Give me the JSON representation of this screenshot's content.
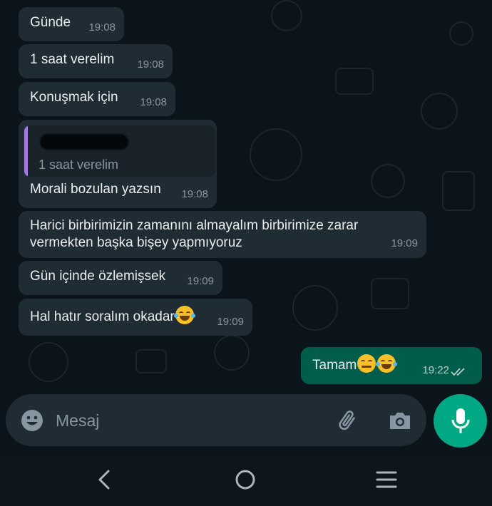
{
  "messages": [
    {
      "text": "Günde",
      "time": "19:08",
      "direction": "in"
    },
    {
      "text": "1 saat verelim",
      "time": "19:08",
      "direction": "in"
    },
    {
      "text": "Konuşmak için",
      "time": "19:08",
      "direction": "in"
    },
    {
      "quoted_text": "1 saat verelim",
      "text": "Morali bozulan yazsın",
      "time": "19:08",
      "direction": "in"
    },
    {
      "text_line1": "Harici birbirimizin zamanını almayalım birbirimize zarar",
      "text_line2": "vermekten başka bişey yapmıyoruz",
      "time": "19:09",
      "direction": "in"
    },
    {
      "text": "Gün içinde özlemişsek",
      "time": "19:09",
      "direction": "in"
    },
    {
      "text": "Hal hatır soralım okadar",
      "time": "19:09",
      "direction": "in",
      "emoji": "tears-of-joy"
    },
    {
      "text": "Tamam",
      "time": "19:22",
      "direction": "out",
      "emojis": [
        "winking-face",
        "tears-of-joy"
      ],
      "status": "read"
    }
  ],
  "composer": {
    "placeholder": "Mesaj"
  },
  "icons": {
    "emoji": "emoji-icon",
    "attach": "paperclip-icon",
    "camera": "camera-icon",
    "mic": "microphone-icon",
    "nav_back": "back-chevron-icon",
    "nav_home": "home-circle-icon",
    "nav_recents": "recents-menu-icon"
  },
  "colors": {
    "background": "#0b141a",
    "incoming_bubble": "#202c33",
    "outgoing_bubble": "#005c4b",
    "accent": "#00a884",
    "quote_bar": "#a07ae5"
  }
}
